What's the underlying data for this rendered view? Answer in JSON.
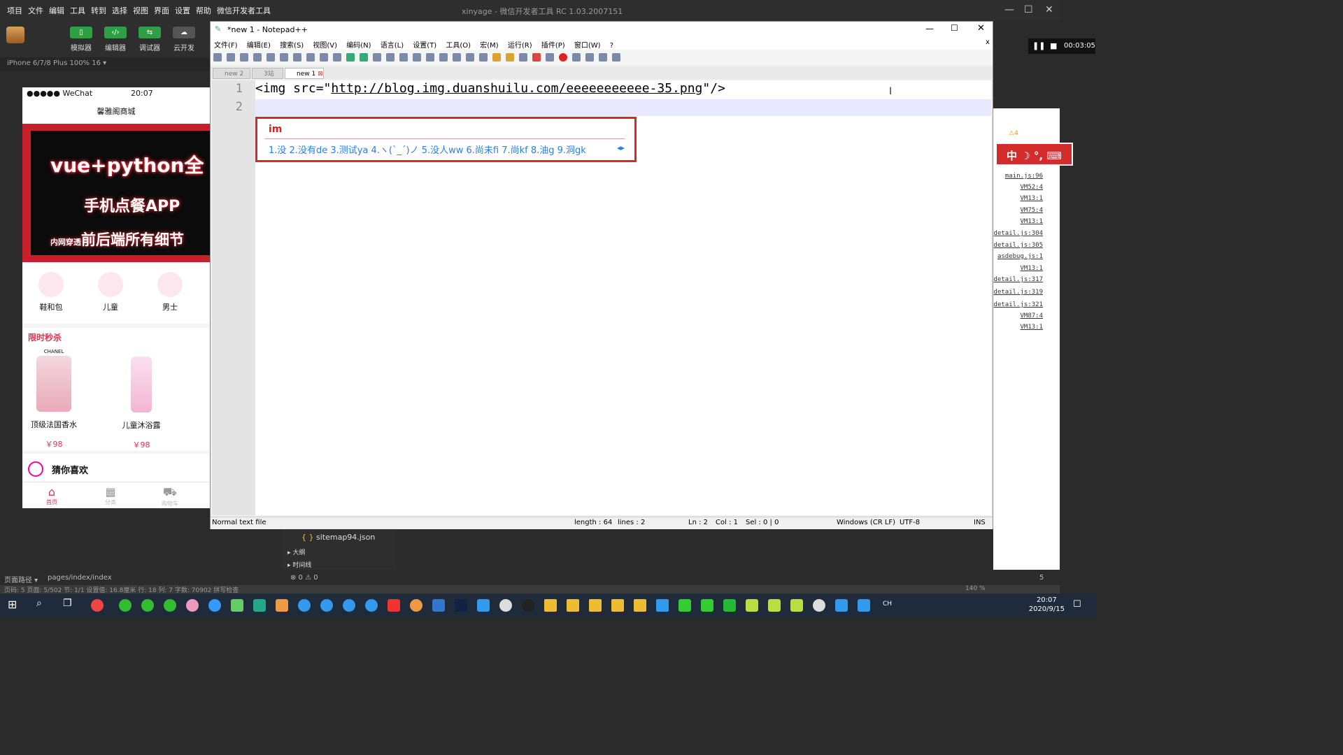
{
  "devtools": {
    "menu": [
      "项目",
      "文件",
      "编辑",
      "工具",
      "转到",
      "选择",
      "视图",
      "界面",
      "设置",
      "帮助",
      "微信开发者工具"
    ],
    "title": "xinyage - 微信开发者工具 RC 1.03.2007151",
    "tools": [
      "模拟器",
      "编辑器",
      "调试器",
      "云开发"
    ],
    "device": "iPhone 6/7/8 Plus 100% 16 ▾",
    "path_label": "页面路径 ▾",
    "path": "pages/index/index",
    "errors": "⊗ 0 ⚠ 0",
    "file": "sitemap94.json",
    "tree_items": [
      "大纲",
      "时间线"
    ],
    "status_line": "页码: 5   页面: 5/502   节: 1/1   设置值: 16.8厘米  行: 18  列: 7  字数: 70902  拼写检查",
    "warn_count": "⚠4",
    "bell_count": "5",
    "zoom": "140 %"
  },
  "phone": {
    "carrier": "●●●●● WeChat",
    "time": "20:07",
    "nav_title": "馨雅阁商城",
    "banner": {
      "line1": "vue+python全",
      "line2": "手机点餐APP",
      "line3_small": "内网穿透",
      "line3": "前后端所有细节"
    },
    "categories": [
      "鞋和包",
      "儿童",
      "男士"
    ],
    "flash_title": "限时秒杀",
    "products": [
      {
        "brand": "CHANEL",
        "name": "顶级法国香水",
        "price": "￥98"
      },
      {
        "brand": "",
        "name": "儿童沐浴露",
        "price": "￥98"
      }
    ],
    "guess": "猜你喜欢",
    "tabs": [
      "首页",
      "分类",
      "购物车"
    ]
  },
  "console": {
    "links": [
      "main.js:96",
      "VM52:4",
      "VM13:1",
      "VM75:4",
      "VM13:1",
      "detail.js:304",
      "detail.js:305",
      "asdebug.js:1",
      "VM13:1",
      "detail.js:317",
      "detail.js:319",
      "detail.js:321",
      "VM87:4",
      "VM13:1"
    ]
  },
  "notepad": {
    "title": "*new 1 - Notepad++",
    "menu": [
      "文件(F)",
      "编辑(E)",
      "搜索(S)",
      "视图(V)",
      "编码(N)",
      "语言(L)",
      "设置(T)",
      "工具(O)",
      "宏(M)",
      "运行(R)",
      "插件(P)",
      "窗口(W)",
      "?"
    ],
    "tabs": [
      "new 2",
      "3站",
      "new 1"
    ],
    "lines": {
      "n1": "1",
      "n2": "2",
      "prefix": "<img src=\"",
      "url": "http://blog.img.duanshuilu.com/eeeeeeeeeee-35.png",
      "suffix": "\"/>"
    },
    "status": {
      "type": "Normal text file",
      "length": "length : 64",
      "lines": "lines : 2",
      "ln": "Ln : 2",
      "col": "Col : 1",
      "sel": "Sel : 0 | 0",
      "eol": "Windows (CR LF)",
      "enc": "UTF-8",
      "mode": "INS"
    }
  },
  "ime": {
    "composition": "im",
    "candidates": "1.没  2.没有de  3.测试ya  4.ヽ(ˋ_ˊ)ノ  5.没人ww  6.尚未fi  7.尚kf  8.油g  9.洞gk",
    "bar": "中 ☽ °, ⌨"
  },
  "recorder": {
    "time": "00:03:05"
  },
  "taskbar": {
    "time": "20:07",
    "date": "2020/9/15",
    "lang": "CH"
  }
}
